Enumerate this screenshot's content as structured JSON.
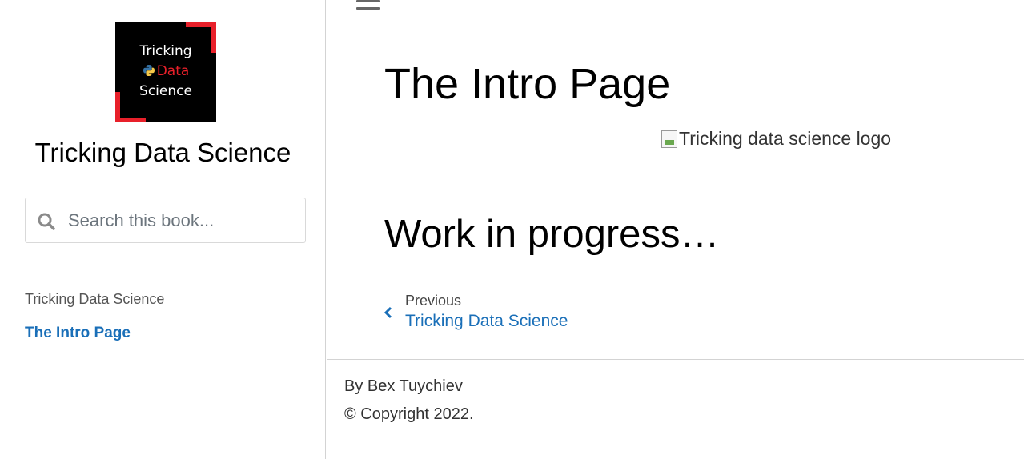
{
  "sidebar": {
    "logo": {
      "line1": "Tricking",
      "line2": "Data",
      "line3": "Science",
      "icon": "python-icon",
      "accent_color": "#e8202a"
    },
    "site_title": "Tricking Data Science",
    "search": {
      "placeholder": "Search this book..."
    },
    "nav_caption": "Tricking Data Science",
    "nav_items": [
      {
        "label": "The Intro Page",
        "active": true
      }
    ]
  },
  "main": {
    "page_title": "The Intro Page",
    "image_alt": "Tricking data science logo",
    "section_heading": "Work in progress…",
    "prev": {
      "label": "Previous",
      "title": "Tricking Data Science"
    }
  },
  "footer": {
    "author": "By Bex Tuychiev",
    "copyright": "© Copyright 2022."
  },
  "colors": {
    "link": "#1a6fb8",
    "accent": "#e8202a"
  }
}
